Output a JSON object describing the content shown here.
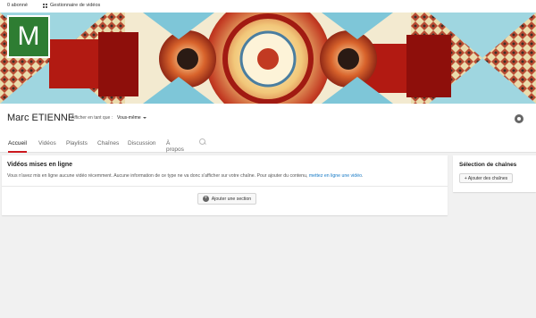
{
  "topbar": {
    "subscribers": "0 abonné",
    "video_manager": "Gestionnaire de vidéos"
  },
  "channel": {
    "avatar_letter": "M",
    "name": "Marc ETIENNE",
    "view_as_label": "Afficher en tant que :",
    "view_as_value": "Vous-même",
    "avatar_color": "#2e7d32",
    "accent": "#cc181e"
  },
  "tabs": [
    {
      "label": "Accueil"
    },
    {
      "label": "Vidéos"
    },
    {
      "label": "Playlists"
    },
    {
      "label": "Chaînes"
    },
    {
      "label": "Discussion"
    },
    {
      "label": "À propos"
    }
  ],
  "main": {
    "title": "Vidéos mises en ligne",
    "message": "Vous n'avez mis en ligne aucune vidéo récemment. Aucune information de ce type ne va donc s'afficher sur votre chaîne. Pour ajouter du contenu, ",
    "link": "mettez en ligne une vidéo",
    "link_suffix": ".",
    "add_section": "Ajouter une section"
  },
  "side": {
    "title": "Sélection de chaînes",
    "add_channels": "+ Ajouter des chaînes"
  },
  "icons": {
    "gear": "gear-icon",
    "search": "search-icon",
    "plus": "plus-icon"
  }
}
